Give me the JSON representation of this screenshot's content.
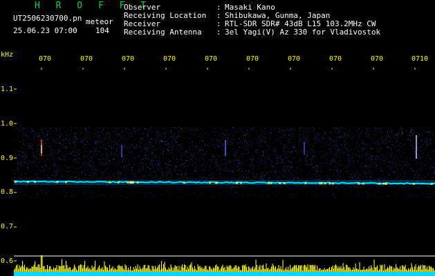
{
  "header": {
    "brand": "H R O F F T",
    "filename": "UT2506230700.pn",
    "superscript": "meteor",
    "datetime": "25.06.23 07:00",
    "count": "104"
  },
  "meta": [
    {
      "label": "Observer",
      "value": "Masaki Kano"
    },
    {
      "label": "Receiving Location",
      "value": "Shibukawa, Gunma, Japan"
    },
    {
      "label": "Receiver",
      "value": "RTL-SDR SDR# 43dB L15 103.2MHz CW"
    },
    {
      "label": "Receiving Antenna",
      "value": "3el Yagi(V) Az 330 for Vladivostok"
    }
  ],
  "axis": {
    "unit": "kHz",
    "y_labels": [
      "1.1",
      "1.0",
      "0.9",
      "0.8",
      "0.7",
      "0.6"
    ],
    "x_labels": [
      "070",
      "070",
      "070",
      "070",
      "070",
      "070",
      "070",
      "070",
      "070",
      "0710"
    ]
  },
  "colors": {
    "background": "#000000",
    "brand": "#00d84a",
    "text": "#ffffff",
    "axis_label": "#ffff00",
    "noise": "#1e3cc8",
    "carrier": "#00e0ff",
    "level_bars": "#ffff00",
    "level_base": "#00d8ff"
  }
}
